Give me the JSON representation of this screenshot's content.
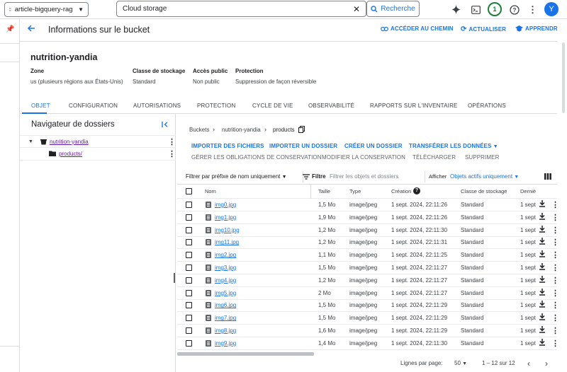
{
  "topbar": {
    "project": "article-bigquery-rag",
    "search_value": "Cloud storage",
    "search_button": "Recherche",
    "notifications": "1",
    "avatar_letter": "Y"
  },
  "header": {
    "title": "Informations sur le bucket",
    "actions": {
      "path": "ACCÉDER AU CHEMIN",
      "refresh": "ACTUALISER",
      "learn": "APPRENDRE"
    }
  },
  "bucket": {
    "name": "nutrition-yandia",
    "meta": [
      {
        "label": "Zone",
        "value": "us (plusieurs régions aux États-Unis)"
      },
      {
        "label": "Classe de stockage",
        "value": "Standard"
      },
      {
        "label": "Accès public",
        "value": "Non public"
      },
      {
        "label": "Protection",
        "value": "Suppression de façon réversible"
      }
    ]
  },
  "tabs": [
    "OBJET",
    "CONFIGURATION",
    "AUTORISATIONS",
    "PROTECTION",
    "CYCLE DE VIE",
    "OBSERVABILITÉ",
    "RAPPORTS SUR L'INVENTAIRE",
    "OPÉRATIONS"
  ],
  "folder_browser": {
    "title": "Navigateur de dossiers",
    "root": "nutrition-yandia",
    "child": "products/"
  },
  "breadcrumb": [
    "Buckets",
    "nutrition-yandia",
    "products"
  ],
  "actions": {
    "upload_files": "IMPORTER DES FICHIERS",
    "upload_folder": "IMPORTER UN DOSSIER",
    "create_folder": "CRÉER UN DOSSIER",
    "transfer": "TRANSFÉRER LES DONNÉES",
    "retention": "GÉRER LES OBLIGATIONS DE CONSERVATION",
    "edit_access": "MODIFIER LA CONSERVATION",
    "download": "TÉLÉCHARGER",
    "delete": "SUPPRIMER"
  },
  "filter": {
    "prefix": "Filtrer par préfixe de nom uniquement",
    "filter_label": "Filtre",
    "placeholder": "Filtrer les objets et dossiers",
    "show_label": "Afficher",
    "show_value": "Objets actifs uniquement"
  },
  "table": {
    "headers": {
      "name": "Nom",
      "size": "Taille",
      "type": "Type",
      "created": "Création",
      "class": "Classe de stockage",
      "last": "Derniè"
    },
    "rows": [
      {
        "name": "img0.jpg",
        "size": "1,5 Mo",
        "type": "image/jpeg",
        "created": "1 sept. 2024, 22:11:26",
        "class": "Standard",
        "last": "1 sept"
      },
      {
        "name": "img1.jpg",
        "size": "1,9 Mo",
        "type": "image/jpeg",
        "created": "1 sept. 2024, 22:11:26",
        "class": "Standard",
        "last": "1 sept"
      },
      {
        "name": "img10.jpg",
        "size": "1,2 Mo",
        "type": "image/jpeg",
        "created": "1 sept. 2024, 22:11:30",
        "class": "Standard",
        "last": "1 sept"
      },
      {
        "name": "img11.jpg",
        "size": "1,2 Mo",
        "type": "image/jpeg",
        "created": "1 sept. 2024, 22:11:31",
        "class": "Standard",
        "last": "1 sept"
      },
      {
        "name": "img2.jpg",
        "size": "1,1 Mo",
        "type": "image/jpeg",
        "created": "1 sept. 2024, 22:11:25",
        "class": "Standard",
        "last": "1 sept"
      },
      {
        "name": "img3.jpg",
        "size": "1,5 Mo",
        "type": "image/jpeg",
        "created": "1 sept. 2024, 22:11:27",
        "class": "Standard",
        "last": "1 sept"
      },
      {
        "name": "img4.jpg",
        "size": "1,2 Mo",
        "type": "image/jpeg",
        "created": "1 sept. 2024, 22:11:27",
        "class": "Standard",
        "last": "1 sept"
      },
      {
        "name": "img5.jpg",
        "size": "2 Mo",
        "type": "image/jpeg",
        "created": "1 sept. 2024, 22:11:27",
        "class": "Standard",
        "last": "1 sept"
      },
      {
        "name": "img6.jpg",
        "size": "1,5 Mo",
        "type": "image/jpeg",
        "created": "1 sept. 2024, 22:11:29",
        "class": "Standard",
        "last": "1 sept"
      },
      {
        "name": "img7.jpg",
        "size": "1,5 Mo",
        "type": "image/jpeg",
        "created": "1 sept. 2024, 22:11:29",
        "class": "Standard",
        "last": "1 sept"
      },
      {
        "name": "img8.jpg",
        "size": "1,6 Mo",
        "type": "image/jpeg",
        "created": "1 sept. 2024, 22:11:29",
        "class": "Standard",
        "last": "1 sept"
      },
      {
        "name": "img9.jpg",
        "size": "1,4 Mo",
        "type": "image/jpeg",
        "created": "1 sept. 2024, 22:11:30",
        "class": "Standard",
        "last": "1 sept"
      }
    ]
  },
  "pagination": {
    "label": "Lignes par page:",
    "per_page": "50",
    "range": "1 – 12 sur 12"
  }
}
